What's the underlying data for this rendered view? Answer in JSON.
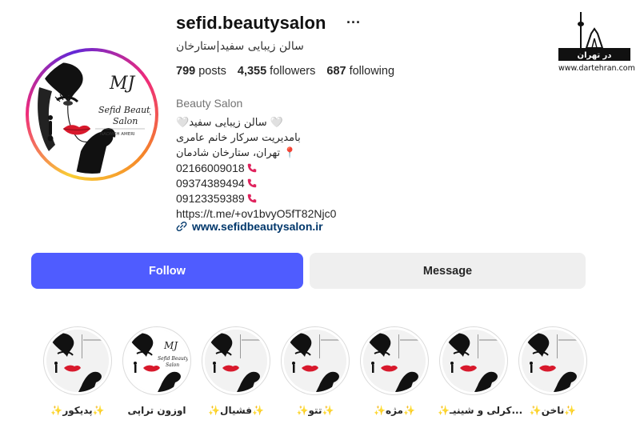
{
  "profile": {
    "username": "sefid.beautysalon",
    "more_label": "···",
    "full_name": "سالن زیبایی سفید|ستارخان",
    "stats": {
      "posts_count": "799",
      "posts_label": "posts",
      "followers_count": "4,355",
      "followers_label": "followers",
      "following_count": "687",
      "following_label": "following"
    },
    "category": "Beauty Salon",
    "bio_lines": [
      "🤍سالن زیبایی سفید 🤍",
      "بامدیریت سرکار خانم عامری",
      "تهران، ستارخان شادمان 📍",
      "02166009018",
      "09374389494",
      "09123359389",
      "https://t.me/+ov1bvyO5fT82Njc0"
    ],
    "website": "www.sefidbeautysalon.ir",
    "avatar_text": {
      "monogram": "MJ",
      "line1": "Sefid Beauty",
      "line2": "Salon",
      "line3": "NAOMEH AMERI"
    }
  },
  "actions": {
    "follow_label": "Follow",
    "message_label": "Message"
  },
  "highlights": [
    {
      "label": "✨پدیکور✨"
    },
    {
      "label": "اوزون تراپی"
    },
    {
      "label": "✨فشیال✨"
    },
    {
      "label": "✨تتو✨"
    },
    {
      "label": "✨مژه✨"
    },
    {
      "label": "✨کرلی و شینیـ..."
    },
    {
      "label": "✨ناخن✨"
    }
  ],
  "watermark": {
    "brand_text": "در تهران",
    "url": "www.dartehran.com"
  },
  "colors": {
    "follow_button": "#4f5cff",
    "message_button": "#efefef",
    "link": "#00376b",
    "phone_icon": "#e0245e"
  }
}
